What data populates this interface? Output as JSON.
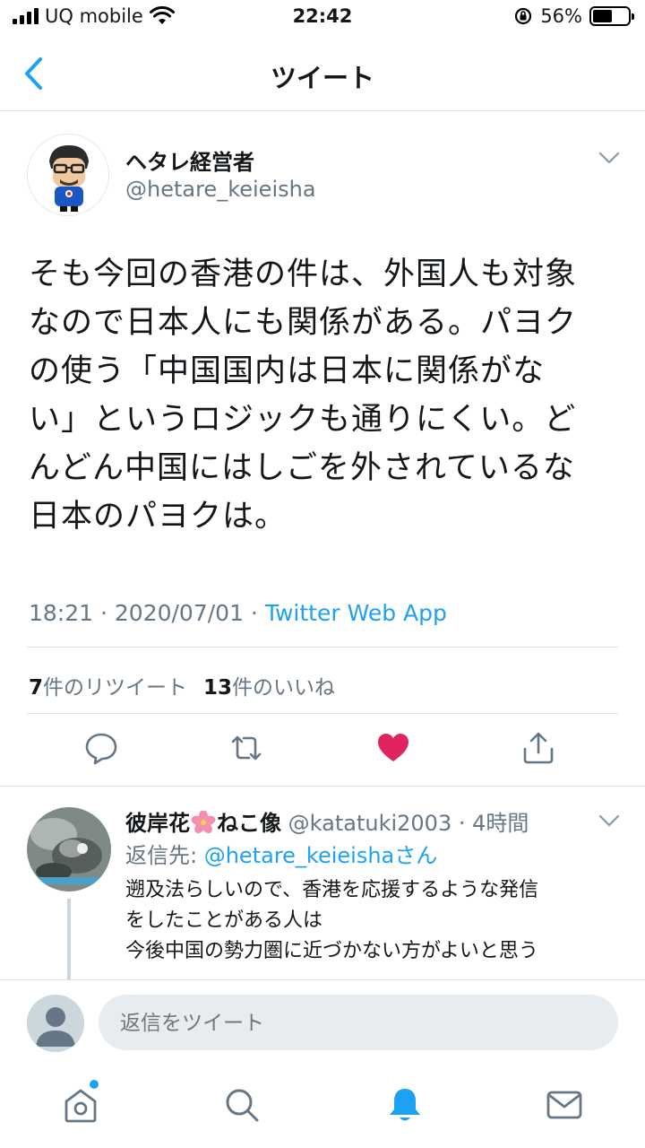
{
  "status_bar": {
    "carrier": "UQ mobile",
    "time": "22:42",
    "battery_percent": "56%",
    "battery_level": 0.56
  },
  "nav": {
    "title": "ツイート"
  },
  "tweet": {
    "author_name": "ヘタレ経営者",
    "author_handle": "@hetare_keieisha",
    "text_lines": [
      "そも今回の香港の件は、外国人も対象",
      "なので日本人にも関係がある。パヨク",
      "の使う「中国国内は日本に関係がな",
      "い」というロジックも通りにくい。ど",
      "んどん中国にはしごを外されているな",
      "日本のパヨクは。"
    ],
    "timestamp": "18:21 · 2020/07/01 · ",
    "source": "Twitter Web App",
    "retweet_count": "7",
    "retweet_label": "件のリツイート",
    "like_count": "13",
    "like_label": "件のいいね"
  },
  "icons": {
    "reply": "reply-icon",
    "retweet": "retweet-icon",
    "like": "heart-icon",
    "share": "share-icon"
  },
  "reply": {
    "name_part1": "彼岸花",
    "name_part2": "ねこ像",
    "handle": "@katatuki2003",
    "time": " · 4時間",
    "replying_prefix": "返信先: ",
    "replying_mention": "@hetare_keieisha",
    "replying_suffix": "さん",
    "body_lines": [
      "遡及法らしいので、香港を応援するような発信",
      "をしたことがある人は",
      "今後中国の勢力圏に近づかない方がよいと思う"
    ]
  },
  "compose": {
    "placeholder": "返信をツイート"
  },
  "colors": {
    "accent": "#1da1f2",
    "like": "#e0245e",
    "secondary_text": "#657786",
    "divider": "#dfe3e6"
  }
}
